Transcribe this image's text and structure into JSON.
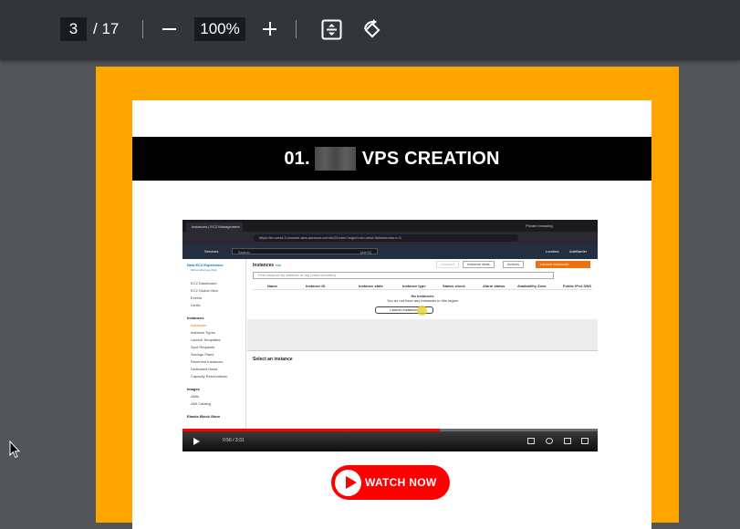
{
  "toolbar": {
    "current_page": "3",
    "page_total": "/ 17",
    "zoom": "100%",
    "icons": [
      "zoom-out-icon",
      "zoom-in-icon",
      "fit-page-icon",
      "rotate-icon"
    ]
  },
  "page": {
    "colors": {
      "border": "#ffa500",
      "banner": "#000000",
      "watch_button": "#ff0000"
    },
    "banner": {
      "prefix": "01.",
      "suffix": "VPS CREATION"
    },
    "video": {
      "browser_tab": "Instances | EC2 Management C",
      "second_tab": "Private browsing",
      "url": "https://eu-west-3.console.aws.amazon.com/ec2/home?region=eu-west-3#Instances:v=3",
      "aws_bar": {
        "services": "Services",
        "search": "Search",
        "shortcut": "[Alt+S]",
        "region": "Londres",
        "account": "AdeBarrier"
      },
      "sidebar": {
        "new_experience": "New EC2 Experience",
        "tell_us": "Tell us what you think",
        "items": [
          "EC2 Dashboard",
          "EC2 Global View",
          "Events",
          "Limits"
        ],
        "instances_header": "Instances",
        "instances_items": [
          "Instances",
          "Instance Types",
          "Launch Templates",
          "Spot Requests",
          "Savings Plans",
          "Reserved Instances",
          "Dedicated Hosts",
          "Capacity Reservations"
        ],
        "images_header": "Images",
        "images_items": [
          "AMIs",
          "AMI Catalog"
        ],
        "ebs_header": "Elastic Block Store"
      },
      "main": {
        "title": "Instances",
        "info": "Info",
        "connect": "Connect",
        "instance_state": "Instance state",
        "actions": "Actions",
        "launch": "Launch instances",
        "filter_placeholder": "Find instance by attribute or tag (case-sensitive)",
        "columns": [
          "Name",
          "Instance ID",
          "Instance state",
          "Instance type",
          "Status check",
          "Alarm status",
          "Availability Zone",
          "Public IPv4 DNS"
        ],
        "no_instances": "No instances",
        "no_instances_sub": "You do not have any instances in this region",
        "launch_button": "Launch instances",
        "select_instance": "Select an instance"
      },
      "time": "0:56 / 3:31",
      "progress": 0.62
    },
    "watch_button": "WATCH NOW"
  }
}
